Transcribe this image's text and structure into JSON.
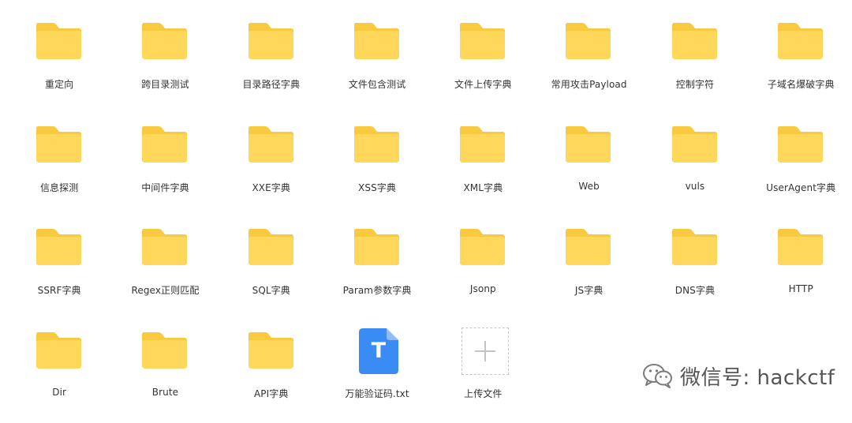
{
  "colors": {
    "folder_back": "#f9c93f",
    "folder_front": "#ffd75a",
    "txt_icon_blue": "#3a8cf4",
    "label_text": "#333333"
  },
  "items": [
    {
      "label": "重定向",
      "icon": "folder-icon"
    },
    {
      "label": "跨目录测试",
      "icon": "folder-icon"
    },
    {
      "label": "目录路径字典",
      "icon": "folder-icon"
    },
    {
      "label": "文件包含测试",
      "icon": "folder-icon"
    },
    {
      "label": "文件上传字典",
      "icon": "folder-icon"
    },
    {
      "label": "常用攻击Payload",
      "icon": "folder-icon"
    },
    {
      "label": "控制字符",
      "icon": "folder-icon"
    },
    {
      "label": "子域名爆破字典",
      "icon": "folder-icon"
    },
    {
      "label": "信息探测",
      "icon": "folder-icon"
    },
    {
      "label": "中间件字典",
      "icon": "folder-icon"
    },
    {
      "label": "XXE字典",
      "icon": "folder-icon"
    },
    {
      "label": "XSS字典",
      "icon": "folder-icon"
    },
    {
      "label": "XML字典",
      "icon": "folder-icon"
    },
    {
      "label": "Web",
      "icon": "folder-icon"
    },
    {
      "label": "vuls",
      "icon": "folder-icon"
    },
    {
      "label": "UserAgent字典",
      "icon": "folder-icon"
    },
    {
      "label": "SSRF字典",
      "icon": "folder-icon"
    },
    {
      "label": "Regex正则匹配",
      "icon": "folder-icon"
    },
    {
      "label": "SQL字典",
      "icon": "folder-icon"
    },
    {
      "label": "Param参数字典",
      "icon": "folder-icon"
    },
    {
      "label": "Jsonp",
      "icon": "folder-icon"
    },
    {
      "label": "JS字典",
      "icon": "folder-icon"
    },
    {
      "label": "DNS字典",
      "icon": "folder-icon"
    },
    {
      "label": "HTTP",
      "icon": "folder-icon"
    },
    {
      "label": "Dir",
      "icon": "folder-icon"
    },
    {
      "label": "Brute",
      "icon": "folder-icon"
    },
    {
      "label": "API字典",
      "icon": "folder-icon"
    },
    {
      "label": "万能验证码.txt",
      "icon": "txt-file-icon",
      "icon_letter": "T"
    },
    {
      "label": "上传文件",
      "icon": "upload-plus-icon"
    }
  ],
  "watermark": {
    "text": "微信号: hackctf",
    "icon": "wechat-icon"
  }
}
